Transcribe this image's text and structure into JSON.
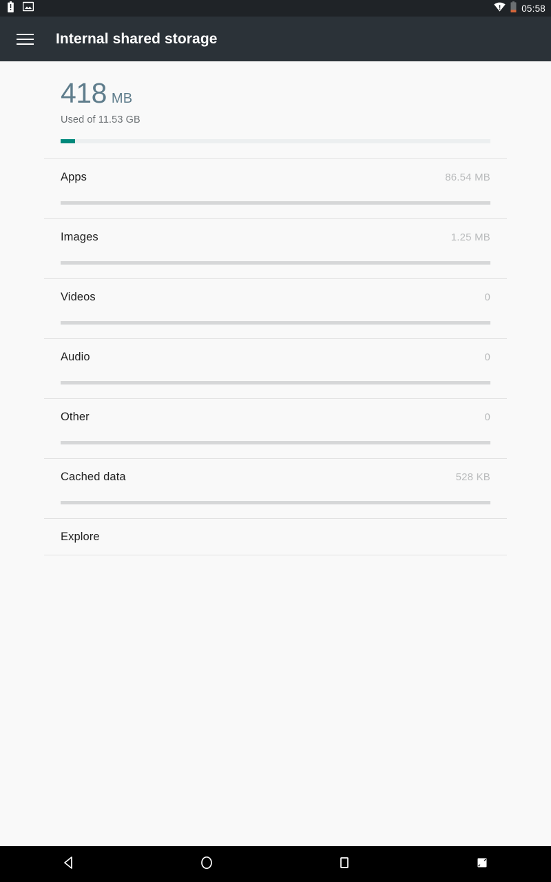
{
  "status_bar": {
    "notification_icons": [
      "battery-alert-icon",
      "image-icon"
    ],
    "wifi_icon": "wifi-no-internet-icon",
    "battery_icon": "battery-low-icon",
    "time": "05:58",
    "background_color": "#1f2327"
  },
  "app_bar": {
    "menu_icon": "hamburger-menu-icon",
    "title": "Internal shared storage",
    "background_color": "#2b3238"
  },
  "summary": {
    "amount": "418",
    "unit": "MB",
    "used_of": "Used of 11.53 GB",
    "progress_percent": 3.4,
    "fill_color": "#00897b",
    "track_color": "#eceff0",
    "amount_color": "#5f7d8c"
  },
  "storage_rows": [
    {
      "label": "Apps",
      "value": "86.54 MB",
      "has_bar": true
    },
    {
      "label": "Images",
      "value": "1.25 MB",
      "has_bar": true
    },
    {
      "label": "Videos",
      "value": "0",
      "has_bar": true
    },
    {
      "label": "Audio",
      "value": "0",
      "has_bar": true
    },
    {
      "label": "Other",
      "value": "0",
      "has_bar": true
    },
    {
      "label": "Cached data",
      "value": "528 KB",
      "has_bar": true
    },
    {
      "label": "Explore",
      "value": "",
      "has_bar": false
    }
  ],
  "nav_bar": {
    "buttons": [
      {
        "name": "back-button",
        "icon": "back-triangle-icon"
      },
      {
        "name": "home-button",
        "icon": "home-circle-icon"
      },
      {
        "name": "recents-button",
        "icon": "recents-square-icon"
      },
      {
        "name": "screenshot-button",
        "icon": "screenshot-icon"
      }
    ],
    "background_color": "#000000"
  }
}
